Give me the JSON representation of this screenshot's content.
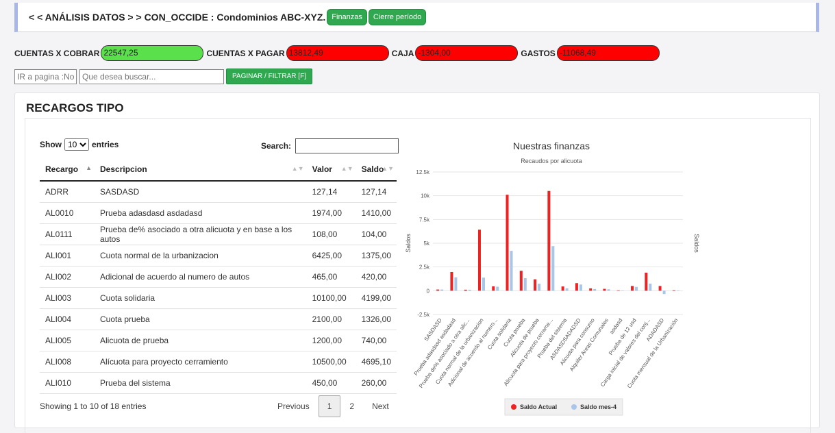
{
  "header": {
    "title": "< < ANÁLISIS DATOS > > CON_OCCIDE : Condominios ABC-XYZ.",
    "btn_finanzas": "Finanzas",
    "btn_cierre": "Cierre período"
  },
  "metrics": {
    "cxc_label": "CUENTAS X COBRAR",
    "cxc_value": "22547,25",
    "cxp_label": "CUENTAS X PAGAR",
    "cxp_value": "13812,49",
    "caja_label": "CAJA",
    "caja_value": "-1304,00",
    "gastos_label": "GASTOS",
    "gastos_value": "-11068,49",
    "green": "#59e04a",
    "red": "#ff0000"
  },
  "search": {
    "page_placeholder": "IR a pagina :No",
    "query_placeholder": "Que desea buscar...",
    "filter_btn": "PAGINAR / FILTRAR [F]"
  },
  "panel": {
    "title": "RECARGOS TIPO"
  },
  "table": {
    "show_label": "Show",
    "entries_label": "entries",
    "entries_value": "10",
    "search_label": "Search:",
    "headers": [
      "Recargo",
      "Descripcion",
      "Valor",
      "Saldo"
    ],
    "rows": [
      [
        "ADRR",
        "SASDASD",
        "127,14",
        "127,14"
      ],
      [
        "AL0010",
        "Prueba adasdasd asdadasd",
        "1974,00",
        "1410,00"
      ],
      [
        "AL0111",
        "Prueba de% asociado a otra alicuota y en base a los autos",
        "108,00",
        "104,00"
      ],
      [
        "ALI001",
        "Cuota normal de la urbanizacion",
        "6425,00",
        "1375,00"
      ],
      [
        "ALI002",
        "Adicional de acuerdo al numero de autos",
        "465,00",
        "420,00"
      ],
      [
        "ALI003",
        "Cuota solidaria",
        "10100,00",
        "4199,00"
      ],
      [
        "ALI004",
        "Cuota prueba",
        "2100,00",
        "1326,00"
      ],
      [
        "ALI005",
        "Alicuota de prueba",
        "1200,00",
        "740,00"
      ],
      [
        "ALI008",
        "Alícuota para proyecto cerramiento",
        "10500,00",
        "4695,10"
      ],
      [
        "ALI010",
        "Prueba del sistema",
        "450,00",
        "260,00"
      ]
    ],
    "info": "Showing 1 to 10 of 18 entries",
    "prev": "Previous",
    "next": "Next",
    "page1": "1",
    "page2": "2"
  },
  "chart_data": {
    "type": "bar",
    "title": "Nuestras finanzas",
    "subtitle": "Recaudos por alicuota",
    "ylabel": "Saldos",
    "ylabel_right": "Saldos",
    "ylim": [
      -2500,
      12500
    ],
    "yticks": [
      "-2.5k",
      "0",
      "2.5k",
      "5k",
      "7.5k",
      "10k",
      "12.5k"
    ],
    "categories": [
      "SASDASD",
      "Prueba adasdasd asdadasd",
      "Prueba de% asociado a otra alic...",
      "Cuota normal de la urbanizacion",
      "Adicional de acuerdo al numero...",
      "Cuota solidaria",
      "Cuota prueba",
      "Alicuota de prueba",
      "Alícuota para proyecto cerrame...",
      "Prueba del sistema",
      "ASDASDSADADSD",
      "Alicuota para consumo",
      "Alquiler Areas Comunales",
      "asdasd",
      "Prueba de 12 usd",
      "Carga inicial de valores del conj...",
      "ADADASD",
      "Cuota mensual de la Urbanización"
    ],
    "series": [
      {
        "name": "Saldo Actual",
        "color": "#ee2222",
        "values": [
          127,
          1974,
          108,
          6425,
          465,
          10100,
          2100,
          1200,
          10500,
          450,
          800,
          250,
          200,
          50,
          500,
          1900,
          500,
          60
        ]
      },
      {
        "name": "Saldo mes-4",
        "color": "#a9c6e8",
        "values": [
          127,
          1410,
          104,
          1375,
          420,
          4199,
          1326,
          740,
          4695,
          260,
          650,
          180,
          150,
          40,
          400,
          750,
          -350,
          40
        ]
      }
    ]
  }
}
